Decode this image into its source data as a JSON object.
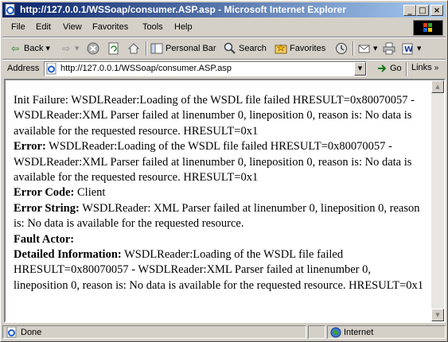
{
  "window": {
    "title": "http://127.0.0.1/WSSoap/consumer.ASP.asp - Microsoft Internet Explorer"
  },
  "caption_buttons": {
    "minimize": "_",
    "maximize": "□",
    "close": "×"
  },
  "menu": [
    "File",
    "Edit",
    "View",
    "Favorites",
    "Tools",
    "Help"
  ],
  "toolbar": {
    "back": "Back",
    "personal_bar": "Personal Bar",
    "search": "Search",
    "favorites": "Favorites"
  },
  "address_bar": {
    "label": "Address",
    "url": "http://127.0.0.1/WSSoap/consumer.ASP.asp",
    "go": "Go",
    "links": "Links"
  },
  "content": {
    "init_failure": "Init Failure: WSDLReader:Loading of the WSDL file failed HRESULT=0x80070057 - WSDLReader:XML Parser failed at linenumber 0, lineposition 0, reason is: No data is available for the requested resource. HRESULT=0x1",
    "error_label": "Error:",
    "error_value": "WSDLReader:Loading of the WSDL file failed HRESULT=0x80070057 - WSDLReader:XML Parser failed at linenumber 0, lineposition 0, reason is: No data is available for the requested resource. HRESULT=0x1",
    "error_code_label": "Error Code:",
    "error_code_value": "Client",
    "error_string_label": "Error String:",
    "error_string_value": "WSDLReader: XML Parser failed at linenumber 0, lineposition 0, reason is: No data is available for the requested resource.",
    "fault_actor_label": "Fault Actor:",
    "fault_actor_value": "",
    "detailed_info_label": "Detailed Information:",
    "detailed_info_value": "WSDLReader:Loading of the WSDL file failed HRESULT=0x80070057 - WSDLReader:XML Parser failed at linenumber 0, lineposition 0, reason is: No data is available for the requested resource. HRESULT=0x1"
  },
  "status_bar": {
    "status": "Done",
    "zone": "Internet"
  },
  "colors": {
    "title_start": "#0a246a",
    "title_end": "#a6caf0",
    "chrome": "#d4d0c8"
  },
  "icons": [
    "ie-page-icon",
    "back-arrow-icon",
    "forward-arrow-icon",
    "stop-icon",
    "refresh-icon",
    "home-icon",
    "personal-bar-icon",
    "search-icon",
    "favorites-icon",
    "history-icon",
    "mail-icon",
    "print-icon",
    "edit-icon",
    "go-arrow-icon",
    "windows-logo-icon",
    "globe-icon"
  ]
}
